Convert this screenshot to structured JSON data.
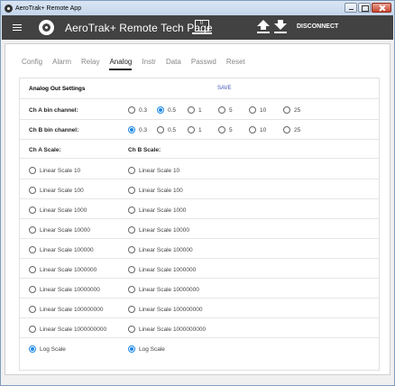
{
  "window": {
    "title": "AeroTrak+ Remote App"
  },
  "appbar": {
    "title": "AeroTrak+ Remote Tech Page",
    "disconnect": "DISCONNECT"
  },
  "tabs": [
    "Config",
    "Alarm",
    "Relay",
    "Analog",
    "Instr",
    "Data",
    "Passwd",
    "Reset"
  ],
  "active_tab": "Analog",
  "card": {
    "title": "Analog Out Settings",
    "save": "SAVE",
    "ch_a_bin_label": "Ch A bin channel:",
    "ch_b_bin_label": "Ch B bin channel:",
    "bin_options": [
      "0.3",
      "0.5",
      "1",
      "5",
      "10",
      "25"
    ],
    "ch_a_bin_selected": "0.5",
    "ch_b_bin_selected": "0.3",
    "ch_a_scale_label": "Ch A Scale:",
    "ch_b_scale_label": "Ch B Scale:",
    "scale_options": [
      "Linear Scale 10",
      "Linear Scale 100",
      "Linear Scale 1000",
      "Linear Scale 10000",
      "Linear Scale 100000",
      "Linear Scale 1000000",
      "Linear Scale 10000000",
      "Linear Scale 100000000",
      "Linear Scale 1000000000",
      "Log Scale"
    ],
    "ch_a_scale_selected": "Log Scale",
    "ch_b_scale_selected": "Log Scale"
  }
}
